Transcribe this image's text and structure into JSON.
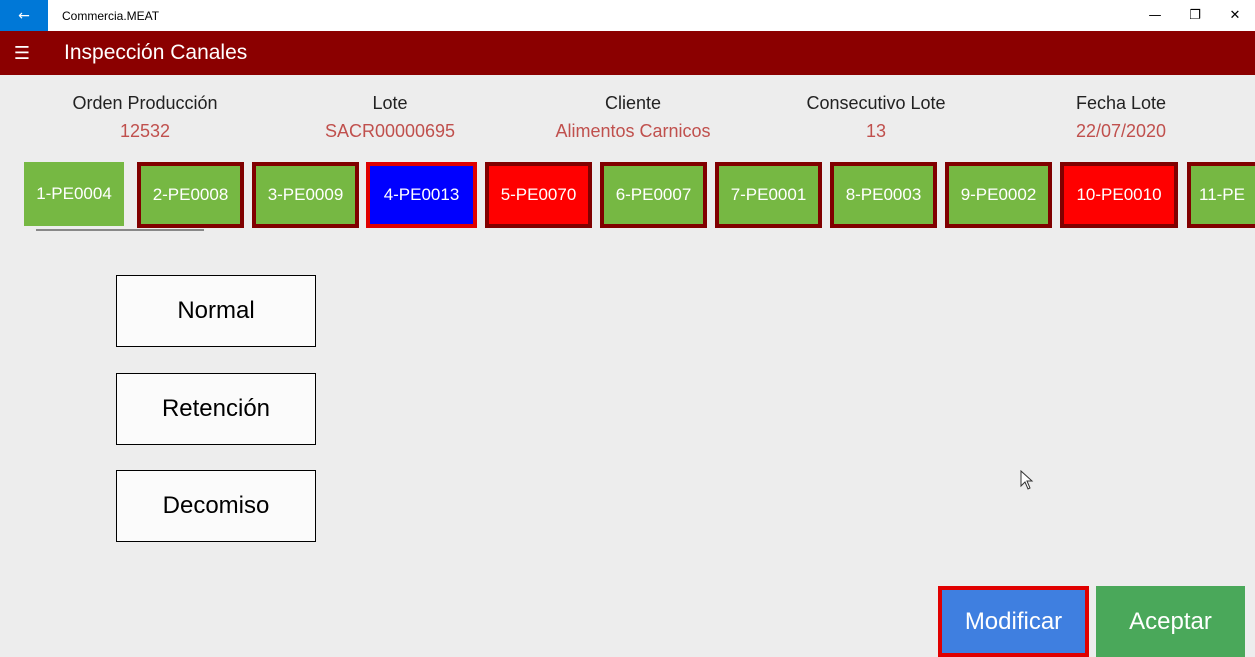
{
  "window": {
    "back_icon": "←",
    "app_title": "Commercia.MEAT",
    "minimize_icon": "—",
    "restore_icon": "❐",
    "close_icon": "✕"
  },
  "header": {
    "menu_icon": "☰",
    "title": "Inspección Canales"
  },
  "info": {
    "orden_label": "Orden Producción",
    "orden_value": "12532",
    "lote_label": "Lote",
    "lote_value": "SACR00000695",
    "cliente_label": "Cliente",
    "cliente_value": "Alimentos Carnicos",
    "consecutivo_label": "Consecutivo Lote",
    "consecutivo_value": "13",
    "fecha_label": "Fecha Lote",
    "fecha_value": "22/07/2020"
  },
  "chips": [
    {
      "label": "1-PE0004",
      "status": "green"
    },
    {
      "label": "2-PE0008",
      "status": "green"
    },
    {
      "label": "3-PE0009",
      "status": "green"
    },
    {
      "label": "4-PE0013",
      "status": "blue"
    },
    {
      "label": "5-PE0070",
      "status": "red"
    },
    {
      "label": "6-PE0007",
      "status": "green"
    },
    {
      "label": "7-PE0001",
      "status": "green"
    },
    {
      "label": "8-PE0003",
      "status": "green"
    },
    {
      "label": "9-PE0002",
      "status": "green"
    },
    {
      "label": "10-PE0010",
      "status": "red"
    },
    {
      "label": "11-PE",
      "status": "green"
    }
  ],
  "options": {
    "normal": "Normal",
    "retencion": "Retención",
    "decomiso": "Decomiso"
  },
  "actions": {
    "modificar": "Modificar",
    "aceptar": "Aceptar"
  },
  "colors": {
    "header": "#8b0000",
    "accent_value": "#c0504d",
    "chip_green": "#76b843",
    "chip_red": "#ff0000",
    "chip_selected": "#0000ff",
    "modificar": "#3f7fe0",
    "aceptar": "#4aa85a"
  }
}
